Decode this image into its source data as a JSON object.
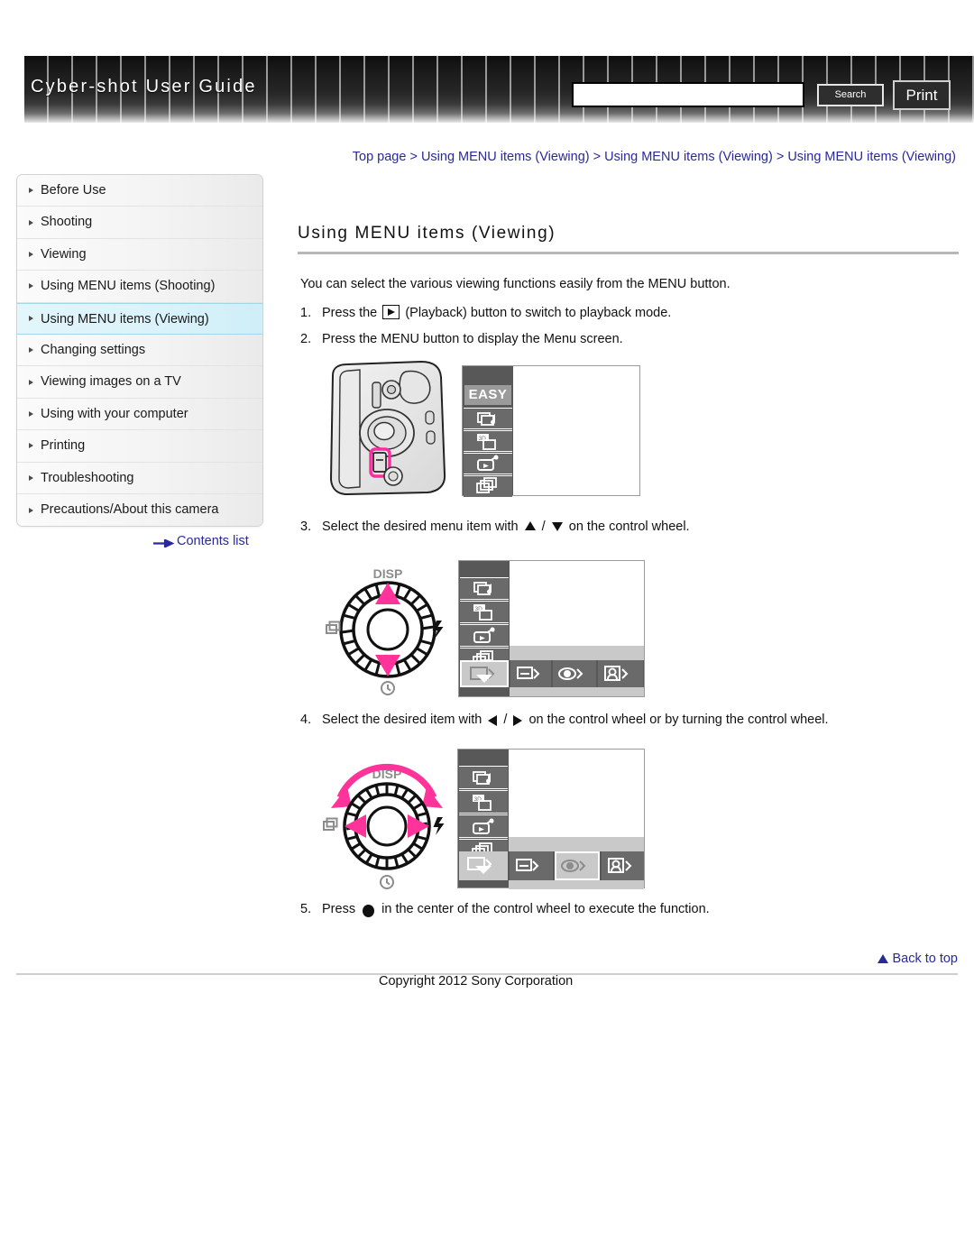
{
  "header": {
    "title": "Cyber-shot User Guide",
    "search_value": "",
    "search_placeholder": "",
    "search_label": "Search",
    "print_label": "Print"
  },
  "breadcrumb": {
    "text": "Top page > Using MENU items (Viewing) > Using MENU items (Viewing) > Using MENU items (Viewing)"
  },
  "sidebar": {
    "items": [
      {
        "label": "Before Use",
        "active": false
      },
      {
        "label": "Shooting",
        "active": false
      },
      {
        "label": "Viewing",
        "active": false
      },
      {
        "label": "Using MENU items (Shooting)",
        "active": false
      },
      {
        "label": "Using MENU items (Viewing)",
        "active": true
      },
      {
        "label": "Changing settings",
        "active": false
      },
      {
        "label": "Viewing images on a TV",
        "active": false
      },
      {
        "label": "Using with your computer",
        "active": false
      },
      {
        "label": "Printing",
        "active": false
      },
      {
        "label": "Troubleshooting",
        "active": false
      },
      {
        "label": "Precautions/About this camera",
        "active": false
      }
    ],
    "contents_list_label": "Contents list"
  },
  "main": {
    "title": "Using MENU items (Viewing)",
    "intro": "You can select the various viewing functions easily from the MENU button.",
    "steps": [
      {
        "num": "1.",
        "pre": "Press the",
        "post": "(Playback) button to switch to playback mode."
      },
      {
        "num": "2.",
        "pre": "Press the MENU button to display the Menu screen.",
        "post": ""
      },
      {
        "num": "3.",
        "pre": "Select the desired menu item with",
        "mid": "/",
        "post": "on the control wheel."
      },
      {
        "num": "4.",
        "pre": "Select the desired item with",
        "mid": "/",
        "post": "on the control wheel or by turning the control wheel."
      },
      {
        "num": "5.",
        "pre": "Press",
        "post": "in the center of the control wheel to execute the function."
      }
    ],
    "figures": {
      "camera": {
        "easy_tag": "EASY",
        "highlight_color": "#ff2ba0",
        "menu_icons": [
          "slideshow-music-icon",
          "3d-viewing-icon",
          "send-by-tv-icon",
          "view-mode-icon"
        ]
      },
      "wheel": {
        "disp_label": "DISP",
        "arrow_color": "#ff3399",
        "top_label": "DISP",
        "left_icon": "image-index-icon",
        "right_icon": "flash-icon",
        "bottom_icon": "self-timer-icon"
      },
      "bottom_bar_icons": [
        "delete-icon",
        "protect-icon",
        "red-eye-correction-icon",
        "beauty-effect-icon"
      ]
    }
  },
  "footer": {
    "back_to_top": "Back to top",
    "copyright": "Copyright 2012 Sony Corporation"
  },
  "colors": {
    "link": "#29299c",
    "accent_pink": "#ff3399",
    "active_nav_bg": "#daf2fa",
    "header_dark": "#1a1a1a"
  }
}
